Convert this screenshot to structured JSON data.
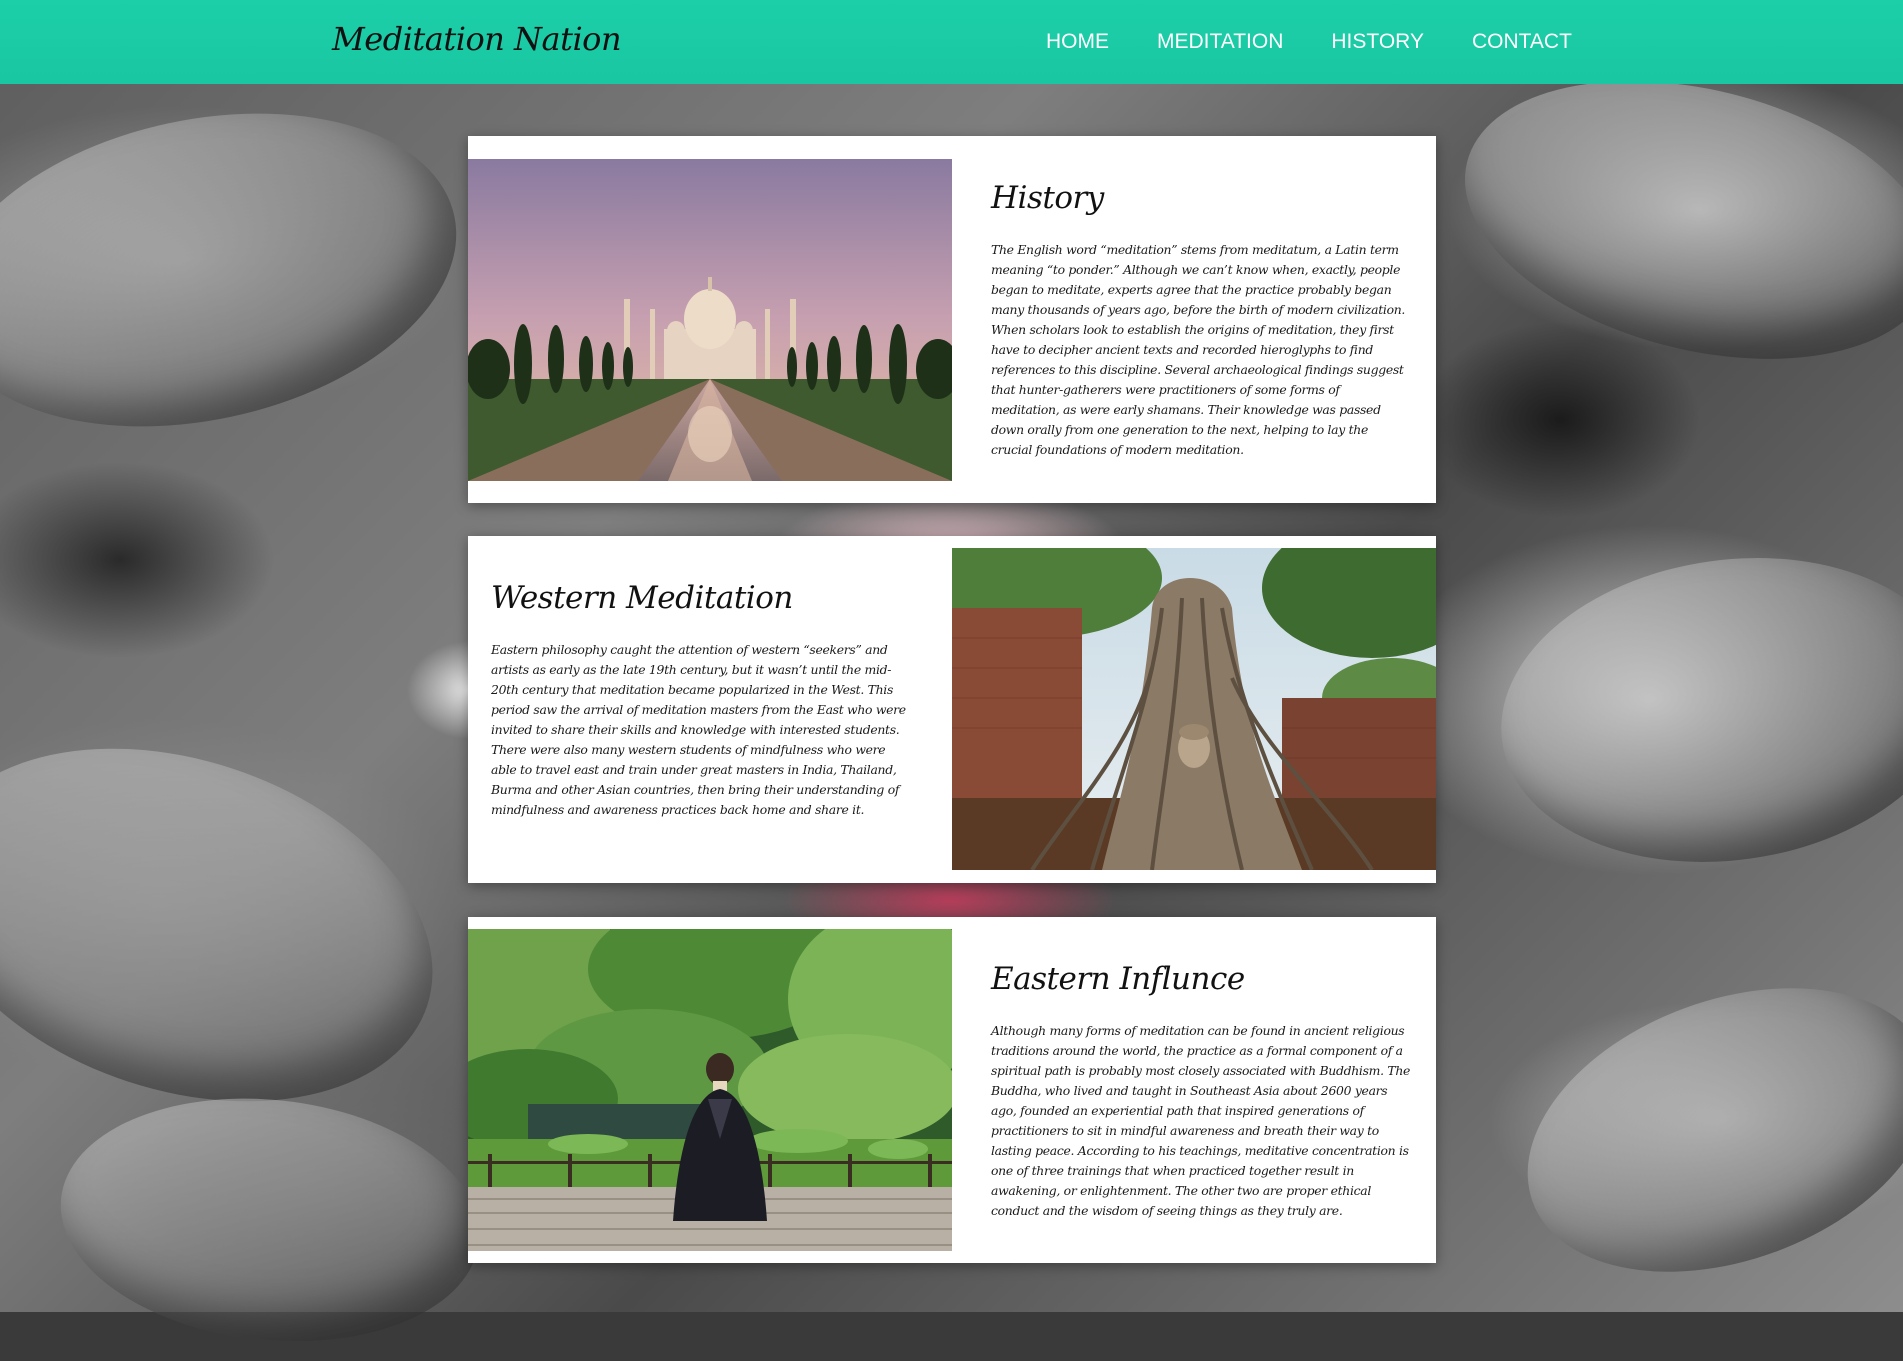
{
  "header": {
    "logo": "Meditation Nation",
    "nav": [
      {
        "label": "HOME"
      },
      {
        "label": "MEDITATION"
      },
      {
        "label": "HISTORY"
      },
      {
        "label": "CONTACT"
      }
    ]
  },
  "sections": [
    {
      "title": "History",
      "image": "taj-mahal-photo",
      "body": "The English word “meditation” stems from meditatum, a Latin term meaning “to ponder.” Although we can’t know when, exactly, people began to meditate, experts agree that the practice probably began many thousands of years ago, before the birth of modern civilization. When scholars look to establish the origins of meditation, they first have to decipher ancient texts and recorded hieroglyphs to find references to this discipline. Several archaeological findings suggest that hunter-gatherers were practitioners of some forms of meditation, as were early shamans. Their knowledge was passed down orally from one generation to the next, helping to lay the crucial foundations of modern meditation."
    },
    {
      "title": "Western Meditation",
      "image": "buddha-head-tree-roots-photo",
      "body": "Eastern philosophy caught the attention of western “seekers” and artists as early as the late 19th century, but it wasn’t until the mid-20th century that meditation became popularized in the West. This period saw the arrival of meditation masters from the East who were invited to share their skills and knowledge with interested students. There were also many western students of mindfulness who were able to travel east and train under great masters in India, Thailand, Burma and other Asian countries, then bring their understanding of mindfulness and awareness practices back home and share it."
    },
    {
      "title": "Eastern Influnce",
      "image": "monk-garden-photo",
      "body": "Although many forms of meditation can be found in ancient religious traditions around the world, the practice as a formal component of a spiritual path is probably most closely associated with Buddhism. The Buddha, who lived and taught in Southeast Asia about 2600 years ago, founded an experiential path that inspired generations of practitioners to sit in mindful awareness and breath their way to lasting peace. According to his teachings, meditative concentration is one of three trainings that when practiced together result in awakening, or enlightenment. The other two are proper ethical conduct and the wisdom of seeing things as they truly are."
    }
  ],
  "colors": {
    "header": "#1ccfa9",
    "nav_text": "#ffffff",
    "card": "#ffffff"
  }
}
